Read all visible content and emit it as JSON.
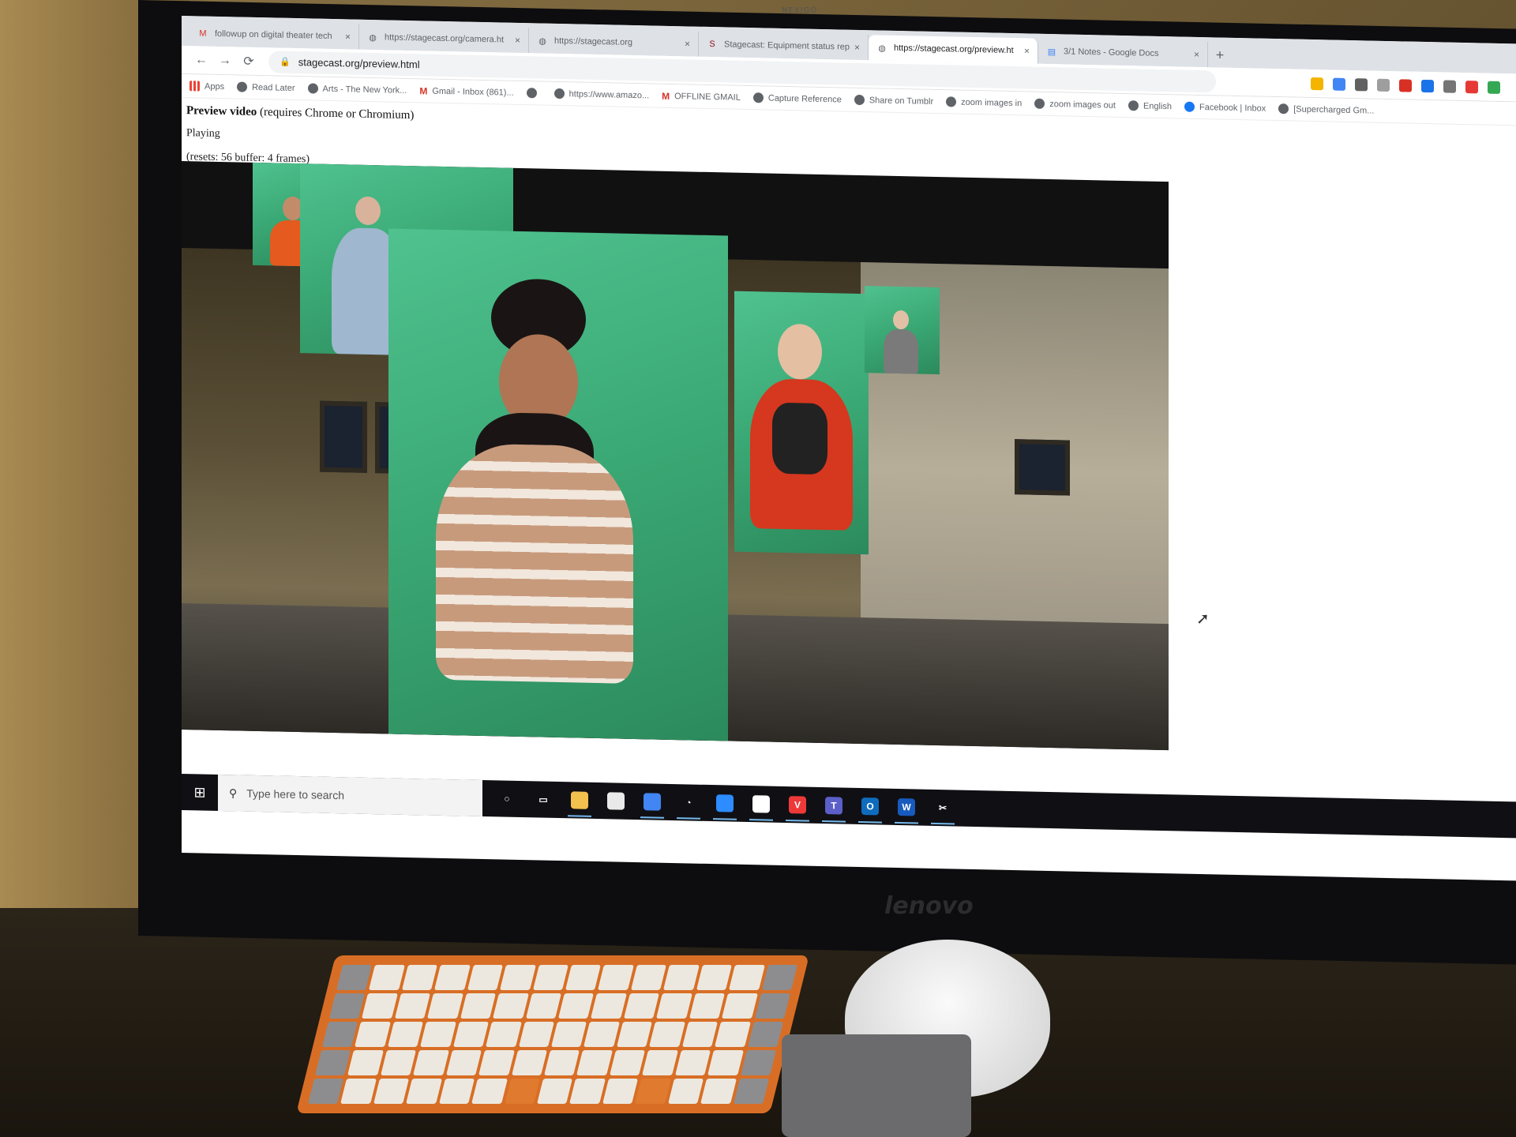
{
  "window": {
    "tabs": [
      {
        "icon": "gmail-icon",
        "label": "followup on digital theater tech",
        "active": false
      },
      {
        "icon": "globe-icon",
        "label": "https://stagecast.org/camera.ht",
        "active": false
      },
      {
        "icon": "globe-icon",
        "label": "https://stagecast.org",
        "active": false
      },
      {
        "icon": "stanford-icon",
        "label": "Stagecast: Equipment status rep",
        "active": false
      },
      {
        "icon": "globe-icon",
        "label": "https://stagecast.org/preview.ht",
        "active": true
      },
      {
        "icon": "docs-icon",
        "label": "3/1 Notes - Google Docs",
        "active": false
      }
    ],
    "new_tab": "+",
    "tab_close": "×"
  },
  "toolbar": {
    "back": "←",
    "forward": "→",
    "reload": "⟳",
    "url": "stagecast.org/preview.html"
  },
  "bookmarks": [
    {
      "icon": "apps-icon",
      "label": "Apps"
    },
    {
      "icon": "globe-icon",
      "label": "Read Later"
    },
    {
      "icon": "nyt-icon",
      "label": "Arts - The New York..."
    },
    {
      "icon": "gmail-icon",
      "label": "Gmail - Inbox (861)..."
    },
    {
      "icon": "globe-icon",
      "label": ""
    },
    {
      "icon": "amazon-icon",
      "label": "https://www.amazo..."
    },
    {
      "icon": "gmail-icon",
      "label": "OFFLINE GMAIL"
    },
    {
      "icon": "globe-icon",
      "label": "Capture Reference"
    },
    {
      "icon": "globe-icon",
      "label": "Share on Tumblr"
    },
    {
      "icon": "globe-icon",
      "label": "zoom images in"
    },
    {
      "icon": "globe-icon",
      "label": "zoom images out"
    },
    {
      "icon": "globe-icon",
      "label": "English"
    },
    {
      "icon": "facebook-icon",
      "label": "Facebook | Inbox"
    },
    {
      "icon": "globe-icon",
      "label": "[Supercharged Gm..."
    }
  ],
  "page": {
    "heading": "Preview video",
    "heading_note": "(requires Chrome or Chromium)",
    "status": "Playing",
    "stats": "(resets: 56 buffer: 4 frames)"
  },
  "taskbar": {
    "search_placeholder": "Type here to search",
    "apps": [
      {
        "name": "cortana-icon",
        "color": "#101014",
        "glyph": "○",
        "running": false
      },
      {
        "name": "task-view-icon",
        "color": "#101014",
        "glyph": "▭",
        "running": false
      },
      {
        "name": "file-explorer-icon",
        "color": "#f2c14e",
        "glyph": "",
        "running": true
      },
      {
        "name": "store-icon",
        "color": "#e9e9e9",
        "glyph": "",
        "running": false
      },
      {
        "name": "chrome-icon",
        "color": "#4285f4",
        "glyph": "",
        "running": true
      },
      {
        "name": "clock-app-icon",
        "color": "#101014",
        "glyph": "◔",
        "running": true
      },
      {
        "name": "zoom-icon",
        "color": "#2d8cff",
        "glyph": "",
        "running": true
      },
      {
        "name": "slack-icon",
        "color": "#ffffff",
        "glyph": "",
        "running": true
      },
      {
        "name": "vivaldi-icon",
        "color": "#ef3939",
        "glyph": "V",
        "running": true
      },
      {
        "name": "teams-icon",
        "color": "#5b5fc7",
        "glyph": "T",
        "running": true
      },
      {
        "name": "outlook-icon",
        "color": "#0f6cbd",
        "glyph": "O",
        "running": true
      },
      {
        "name": "word-icon",
        "color": "#185abd",
        "glyph": "W",
        "running": true
      },
      {
        "name": "snip-icon",
        "color": "#101014",
        "glyph": "✂",
        "running": true
      }
    ]
  },
  "hardware": {
    "camera_brand": "NEXIGO",
    "monitor_brand": "lenovo"
  }
}
